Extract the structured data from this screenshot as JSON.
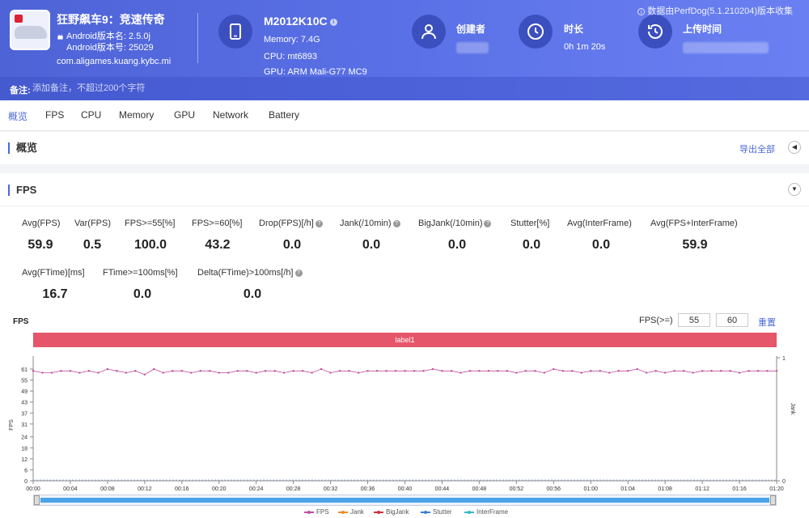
{
  "app": {
    "name": "狂野飙车9：竞速传奇",
    "android_version_name": "Android版本名: 2.5.0j",
    "android_version_code": "Android版本号: 25029",
    "package": "com.aligames.kuang.kybc.mi"
  },
  "device": {
    "model": "M2012K10C",
    "memory": "Memory: 7.4G",
    "cpu": "CPU: mt6893",
    "gpu": "GPU: ARM Mali-G77 MC9"
  },
  "meta": {
    "creator_label": "创建者",
    "duration_label": "时长",
    "duration_value": "0h 1m 20s",
    "upload_label": "上传时间"
  },
  "source_note": "数据由PerfDog(5.1.210204)版本收集",
  "remark": {
    "label": "备注:",
    "placeholder": "添加备注，不超过200个字符"
  },
  "tabs": [
    "概览",
    "FPS",
    "CPU",
    "Memory",
    "GPU",
    "Network",
    "Battery"
  ],
  "overview": {
    "title": "概览",
    "export": "导出全部"
  },
  "fps_section": {
    "title": "FPS"
  },
  "stats_row1": [
    {
      "label": "Avg(FPS)",
      "value": "59.9",
      "help": false
    },
    {
      "label": "Var(FPS)",
      "value": "0.5",
      "help": false
    },
    {
      "label": "FPS>=55[%]",
      "value": "100.0",
      "help": false
    },
    {
      "label": "FPS>=60[%]",
      "value": "43.2",
      "help": false
    },
    {
      "label": "Drop(FPS)[/h]",
      "value": "0.0",
      "help": true
    },
    {
      "label": "Jank(/10min)",
      "value": "0.0",
      "help": true
    },
    {
      "label": "BigJank(/10min)",
      "value": "0.0",
      "help": true
    },
    {
      "label": "Stutter[%]",
      "value": "0.0",
      "help": false
    },
    {
      "label": "Avg(InterFrame)",
      "value": "0.0",
      "help": false
    },
    {
      "label": "Avg(FPS+InterFrame)",
      "value": "59.9",
      "help": false
    }
  ],
  "stats_row2": [
    {
      "label": "Avg(FTime)[ms]",
      "value": "16.7",
      "help": false
    },
    {
      "label": "FTime>=100ms[%]",
      "value": "0.0",
      "help": false
    },
    {
      "label": "Delta(FTime)>100ms[/h]",
      "value": "0.0",
      "help": true
    }
  ],
  "chart_controls": {
    "title": "FPS",
    "fps_ge_label": "FPS(>=)",
    "fps_min": "55",
    "fps_max": "60",
    "reset": "重置",
    "label_bar": "label1"
  },
  "chart_data": {
    "type": "line",
    "ylabel": "FPS",
    "y2label": "Jank",
    "ylim": [
      0,
      61
    ],
    "y_ticks": [
      0,
      6,
      12,
      18,
      24,
      31,
      37,
      43,
      49,
      55,
      61
    ],
    "y2_ticks": [
      0,
      1
    ],
    "x_ticks": [
      "00:00",
      "00:04",
      "00:08",
      "00:12",
      "00:16",
      "00:20",
      "00:24",
      "00:28",
      "00:32",
      "00:36",
      "00:40",
      "00:44",
      "00:48",
      "00:52",
      "00:56",
      "01:00",
      "01:04",
      "01:08",
      "01:12",
      "01:16",
      "01:20"
    ],
    "xlim_seconds": [
      0,
      80
    ],
    "legend": [
      "FPS",
      "Jank",
      "BigJank",
      "Stutter",
      "InterFrame"
    ],
    "series": [
      {
        "name": "FPS",
        "color": "#c0509d",
        "values": [
          60,
          59,
          59,
          60,
          60,
          59,
          60,
          59,
          61,
          60,
          59,
          60,
          58,
          61,
          59,
          60,
          60,
          59,
          60,
          60,
          59,
          59,
          60,
          60,
          59,
          60,
          60,
          59,
          60,
          60,
          59,
          61,
          59,
          60,
          60,
          59,
          60,
          60,
          60,
          60,
          60,
          60,
          60,
          61,
          60,
          60,
          59,
          60,
          60,
          60,
          60,
          60,
          59,
          60,
          60,
          59,
          61,
          60,
          60,
          59,
          60,
          60,
          59,
          60,
          60,
          61,
          59,
          60,
          59,
          60,
          60,
          59,
          60,
          60,
          60,
          60,
          59,
          60,
          60,
          60,
          60
        ]
      },
      {
        "name": "Jank",
        "color": "#f08a2c",
        "values": []
      },
      {
        "name": "BigJank",
        "color": "#d0303a",
        "values": []
      },
      {
        "name": "Stutter",
        "color": "#3a7fd0",
        "values": []
      },
      {
        "name": "InterFrame",
        "color": "#36b7c9",
        "values": []
      }
    ]
  }
}
